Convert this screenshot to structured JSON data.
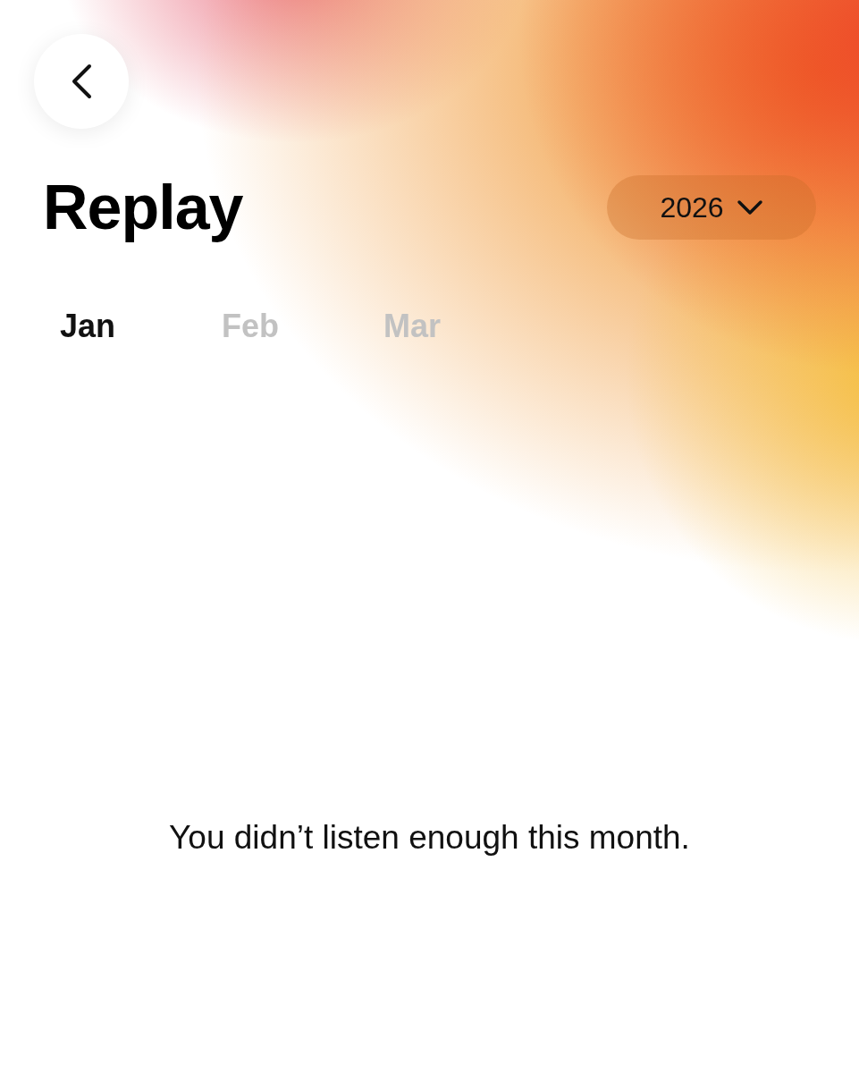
{
  "header": {
    "title": "Replay",
    "year": "2026"
  },
  "tabs": [
    {
      "label": "Jan",
      "selected": true
    },
    {
      "label": "Feb",
      "selected": false
    },
    {
      "label": "Mar",
      "selected": false
    }
  ],
  "message": "You didn’t listen enough this month."
}
